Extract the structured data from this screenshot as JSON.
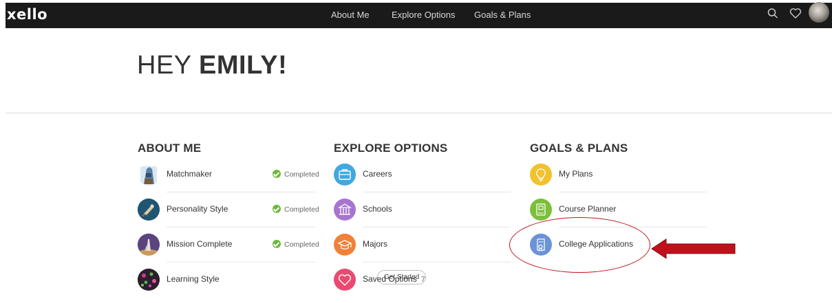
{
  "header": {
    "logo": "xello",
    "nav": [
      "About Me",
      "Explore Options",
      "Goals & Plans"
    ],
    "icons": [
      "search-icon",
      "heart-icon",
      "avatar"
    ]
  },
  "greeting": {
    "prefix": "HEY ",
    "name": "EMILY!"
  },
  "columns": {
    "about_me": {
      "title": "ABOUT ME",
      "items": [
        {
          "label": "Matchmaker",
          "status": "Completed"
        },
        {
          "label": "Personality Style",
          "status": "Completed"
        },
        {
          "label": "Mission Complete",
          "status": "Completed"
        },
        {
          "label": "Learning Style",
          "action": "Get Started"
        }
      ]
    },
    "explore_options": {
      "title": "EXPLORE OPTIONS",
      "items": [
        {
          "label": "Careers",
          "icon": "briefcase-icon",
          "color": "#3fa9e0"
        },
        {
          "label": "Schools",
          "icon": "building-icon",
          "color": "#a775cf"
        },
        {
          "label": "Majors",
          "icon": "graduation-cap-icon",
          "color": "#f0813a"
        },
        {
          "label": "Saved Options",
          "count": "7",
          "icon": "heart-icon",
          "color": "#e94a73"
        }
      ]
    },
    "goals_plans": {
      "title": "GOALS & PLANS",
      "items": [
        {
          "label": "My Plans",
          "icon": "lightbulb-icon",
          "color": "#f2c12e"
        },
        {
          "label": "Course Planner",
          "icon": "book-icon",
          "color": "#7cbf3a"
        },
        {
          "label": "College Applications",
          "icon": "certificate-icon",
          "color": "#6b93d6"
        }
      ]
    }
  },
  "annotation": {
    "ellipse_color": "#c0111b",
    "arrow_color": "#c0111b"
  }
}
